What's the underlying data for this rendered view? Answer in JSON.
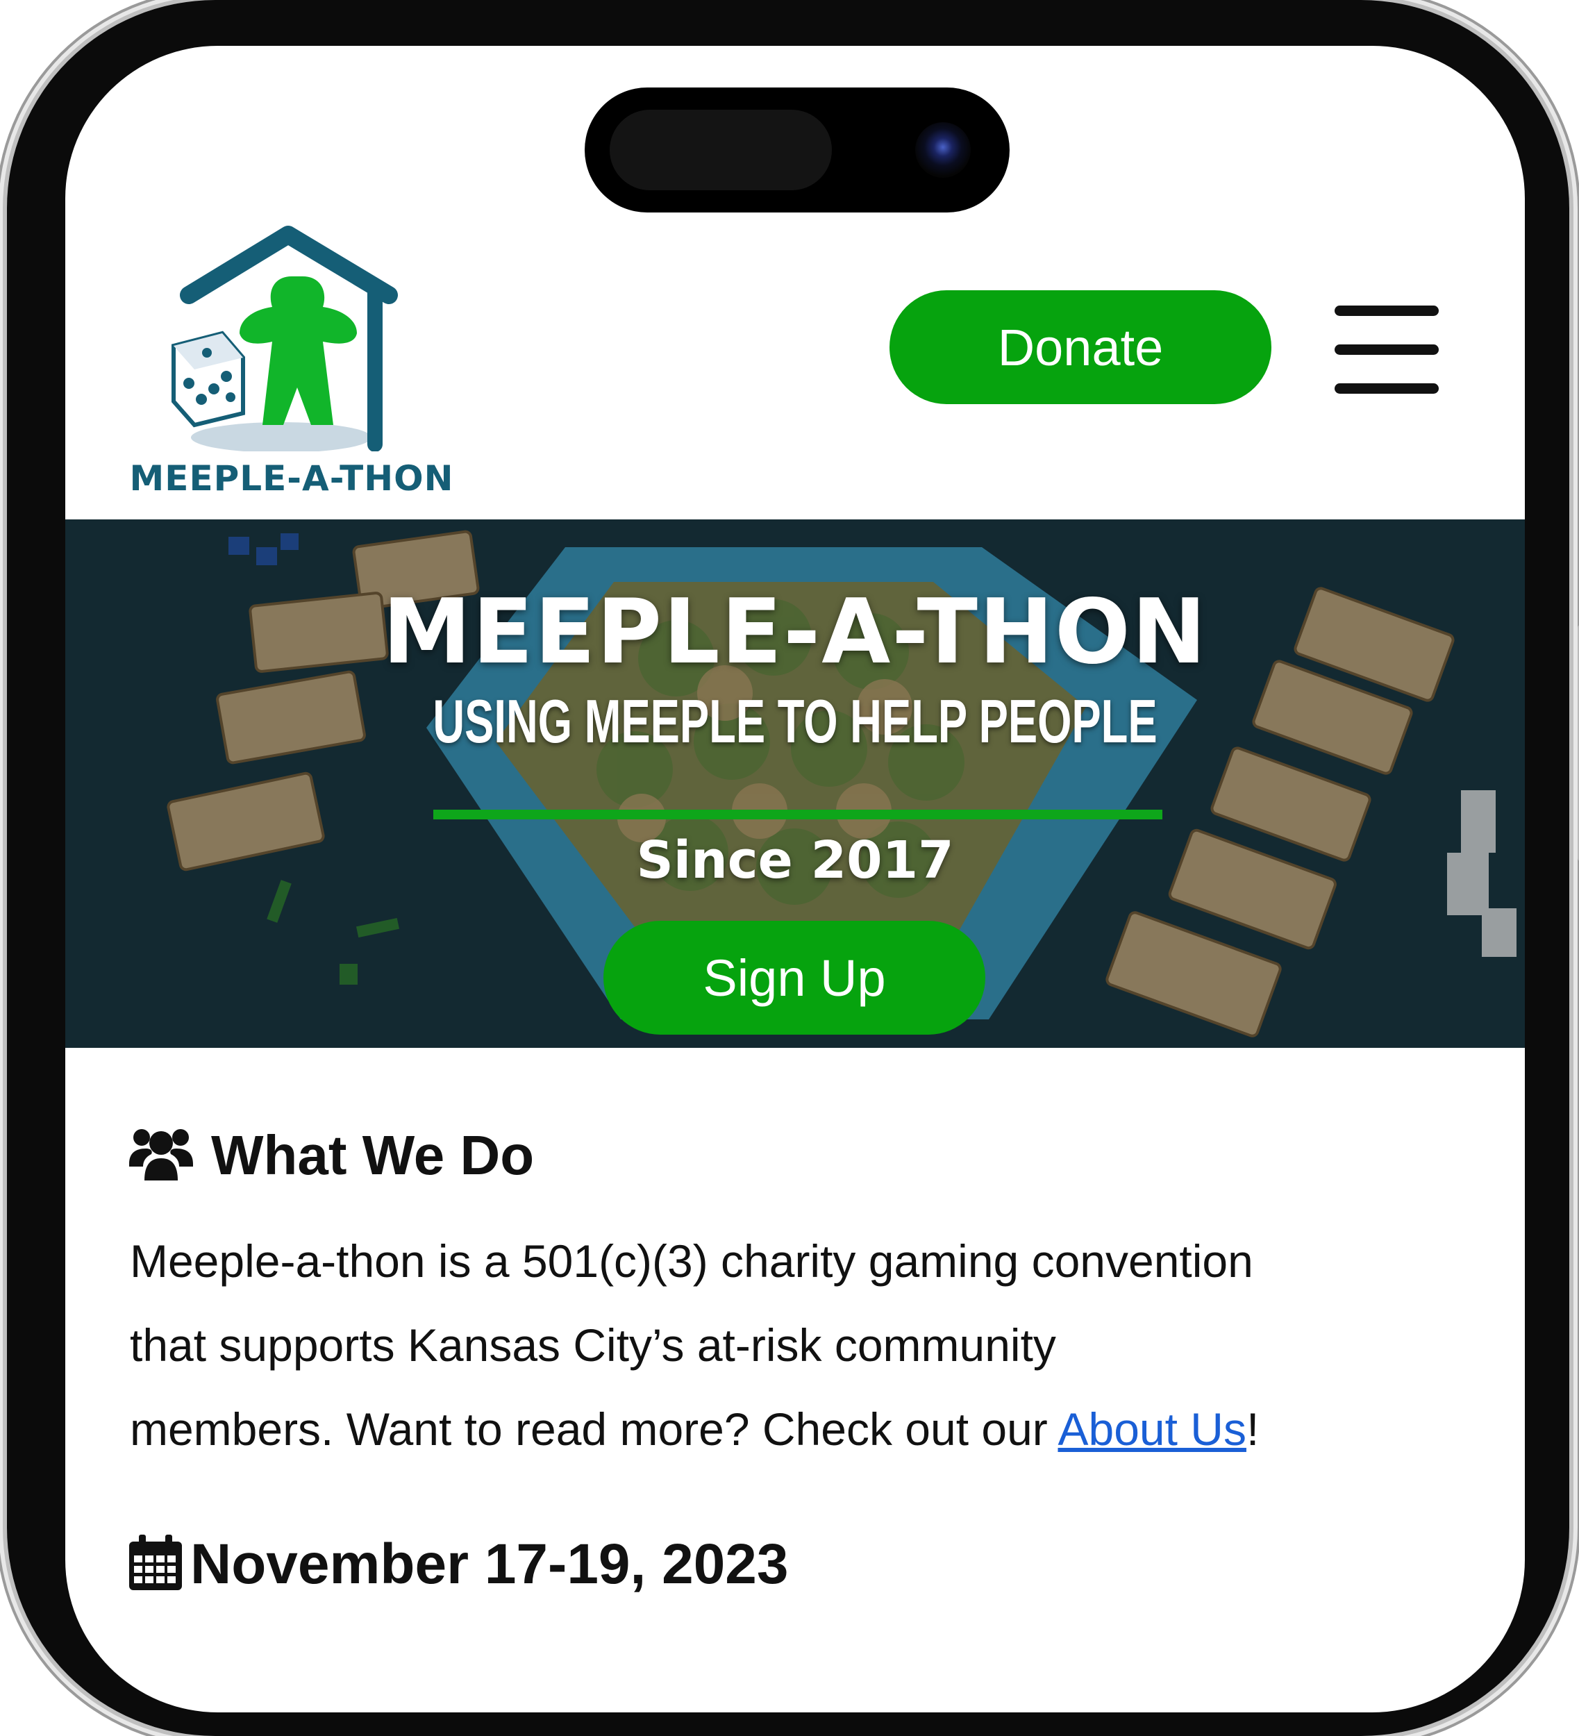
{
  "header": {
    "logo_text": "MEEPLE-A-THON",
    "donate_label": "Donate",
    "menu_icon": "hamburger-menu-icon"
  },
  "hero": {
    "title": "MEEPLE-A-THON",
    "tagline": "USING MEEPLE TO HELP PEOPLE",
    "since": "Since 2017",
    "signup_label": "Sign Up"
  },
  "about": {
    "icon": "users-icon",
    "heading": "What We Do",
    "body_line1": "Meeple-a-thon is a 501(c)(3) charity gaming convention",
    "body_line2": "that supports Kansas City’s at-risk community",
    "body_line3_prefix": "members. Want to read more? Check out our ",
    "link_text": "About Us",
    "body_line3_suffix": "!"
  },
  "event": {
    "icon": "calendar-icon",
    "date": "November 17-19, 2023"
  },
  "colors": {
    "accent_green": "#06a30e",
    "logo_teal": "#155e76",
    "link_blue": "#1a5fd6",
    "hero_bg": "#142a33"
  }
}
